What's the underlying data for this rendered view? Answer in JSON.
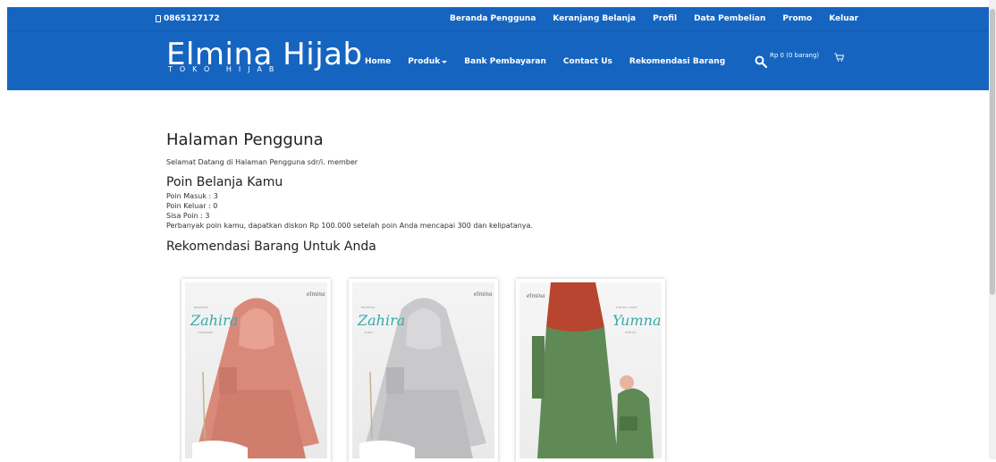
{
  "topbar": {
    "phone": "0865127172",
    "links": [
      "Beranda Pengguna",
      "Keranjang Belanja",
      "Profil",
      "Data Pembelian",
      "Promo",
      "Keluar"
    ]
  },
  "brand": {
    "name": "Elmina Hijab",
    "tagline": "TOKO HIJAB"
  },
  "nav": {
    "items": [
      "Home",
      "Produk",
      "Bank Pembayaran",
      "Contact Us",
      "Rekomendasi Barang"
    ]
  },
  "cart": {
    "summary": "Rp 0 (0 barang)"
  },
  "page": {
    "title": "Halaman Pengguna",
    "welcome": "Selamat Datang di Halaman Pengguna sdr/i. member",
    "points_title": "Poin Belanja Kamu",
    "points": [
      "Poin Masuk : 3",
      "Poin Keluar : 0",
      "Sisa Poin : 3",
      "Perbanyak poin kamu, dapatkan diskon Rp 100.000 setelah poin Anda mencapai 300 dan kelipatanya."
    ],
    "rec_title": "Rekomendasi Barang Untuk Anda"
  },
  "products": [
    {
      "brand": "elmina",
      "name": "Zahira",
      "label": "MUKENA",
      "variant": "CORRANT"
    },
    {
      "brand": "elmina",
      "name": "Zahira",
      "label": "MUKENA",
      "variant": "GREY"
    },
    {
      "brand": "elmina",
      "name": "Yumna",
      "label": "DRESS ARMY",
      "variant": "DRESS"
    }
  ],
  "colors": {
    "primary": "#1565c0",
    "accent_text": "#3aa8a8"
  }
}
